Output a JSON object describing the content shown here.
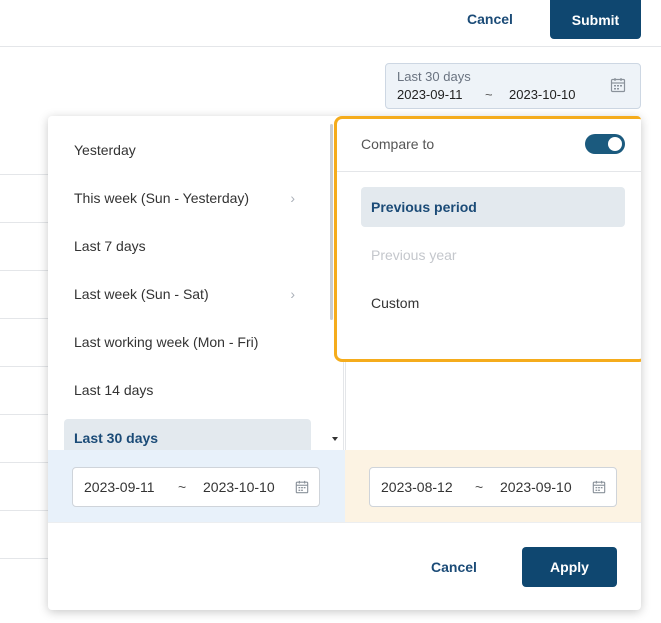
{
  "top_bar": {
    "cancel_label": "Cancel",
    "submit_label": "Submit"
  },
  "date_field": {
    "label": "Last 30 days",
    "from": "2023-09-11",
    "separator": "~",
    "to": "2023-10-10",
    "icon": "calendar-icon"
  },
  "presets": [
    {
      "label": "Yesterday",
      "has_submenu": false,
      "active": false
    },
    {
      "label": "This week (Sun - Yesterday)",
      "has_submenu": true,
      "active": false
    },
    {
      "label": "Last 7 days",
      "has_submenu": false,
      "active": false
    },
    {
      "label": "Last week (Sun - Sat)",
      "has_submenu": true,
      "active": false
    },
    {
      "label": "Last working week (Mon - Fri)",
      "has_submenu": false,
      "active": false
    },
    {
      "label": "Last 14 days",
      "has_submenu": false,
      "active": false
    },
    {
      "label": "Last 30 days",
      "has_submenu": false,
      "active": true
    }
  ],
  "chevron_glyph": "›",
  "compare": {
    "label": "Compare to",
    "enabled": true,
    "options": [
      {
        "label": "Previous period",
        "state": "selected"
      },
      {
        "label": "Previous year",
        "state": "disabled"
      },
      {
        "label": "Custom",
        "state": "normal"
      }
    ],
    "highlight_color": "#f5ac1c"
  },
  "primary_range": {
    "from": "2023-09-11",
    "separator": "~",
    "to": "2023-10-10"
  },
  "compare_range": {
    "from": "2023-08-12",
    "separator": "~",
    "to": "2023-09-10"
  },
  "footer": {
    "cancel_label": "Cancel",
    "apply_label": "Apply"
  },
  "colors": {
    "primary": "#0f4770",
    "primary_text": "#1b4b77",
    "primary_band": "#e8f1fa",
    "compare_band": "#fcf3e3"
  }
}
